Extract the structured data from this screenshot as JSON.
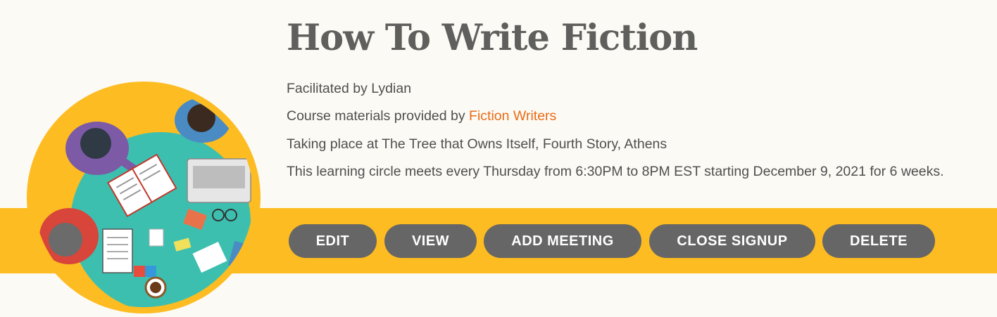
{
  "course": {
    "title": "How To Write Fiction",
    "facilitated": "Facilitated by Lydian",
    "materials_prefix": "Course materials provided by ",
    "materials_link": "Fiction Writers",
    "location": "Taking place at The Tree that Owns Itself, Fourth Story, Athens",
    "schedule": "This learning circle meets every Thursday from 6:30PM to 8PM EST starting December 9, 2021 for 6 weeks."
  },
  "actions": {
    "edit": "EDIT",
    "view": "VIEW",
    "add_meeting": "ADD MEETING",
    "close_signup": "CLOSE SIGNUP",
    "delete": "DELETE"
  },
  "image": {
    "icon": "people-around-table-illustration"
  },
  "colors": {
    "accent_band": "#fdbc21",
    "button_bg": "#666666",
    "link": "#ea6b15",
    "table": "#3dbfb0",
    "background": "#fcfaf5"
  }
}
